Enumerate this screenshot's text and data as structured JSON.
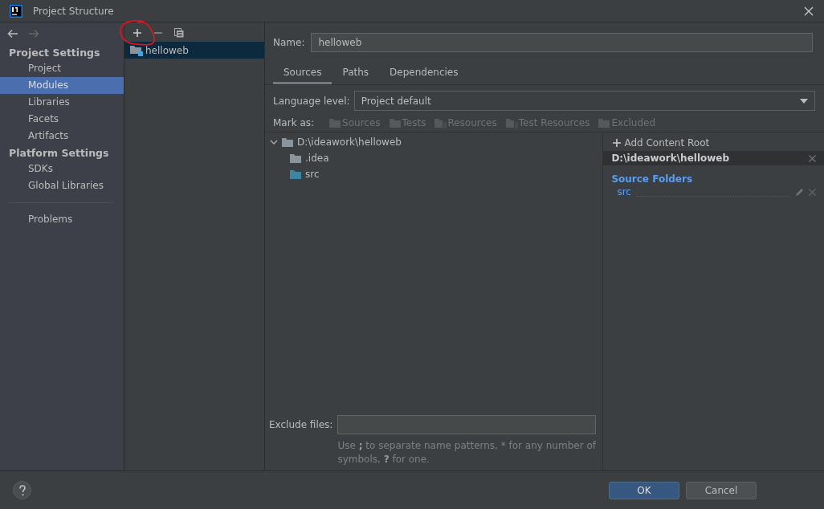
{
  "window": {
    "title": "Project Structure"
  },
  "sidebar": {
    "sections": [
      {
        "heading": "Project Settings",
        "items": [
          {
            "label": "Project",
            "selected": false
          },
          {
            "label": "Modules",
            "selected": true
          },
          {
            "label": "Libraries",
            "selected": false
          },
          {
            "label": "Facets",
            "selected": false
          },
          {
            "label": "Artifacts",
            "selected": false
          }
        ]
      },
      {
        "heading": "Platform Settings",
        "items": [
          {
            "label": "SDKs",
            "selected": false
          },
          {
            "label": "Global Libraries",
            "selected": false
          }
        ]
      }
    ],
    "extra_items": [
      {
        "label": "Problems",
        "selected": false
      }
    ]
  },
  "modules": [
    {
      "label": "helloweb",
      "selected": true
    }
  ],
  "name_field": {
    "label": "Name:",
    "value": "helloweb"
  },
  "tabs": [
    {
      "label": "Sources",
      "selected": true
    },
    {
      "label": "Paths",
      "selected": false
    },
    {
      "label": "Dependencies",
      "selected": false
    }
  ],
  "language_level": {
    "label": "Language level:",
    "value": "Project default"
  },
  "mark_as": {
    "label": "Mark as:",
    "items": [
      {
        "label": "Sources",
        "kind": "sources",
        "disabled": true
      },
      {
        "label": "Tests",
        "kind": "tests",
        "disabled": true
      },
      {
        "label": "Resources",
        "kind": "resources",
        "disabled": true
      },
      {
        "label": "Test Resources",
        "kind": "test-resources",
        "disabled": true
      },
      {
        "label": "Excluded",
        "kind": "excluded",
        "disabled": true
      }
    ]
  },
  "tree": [
    {
      "label": "D:\\ideawork\\helloweb",
      "kind": "folder",
      "expanded": true,
      "children": [
        {
          "label": ".idea",
          "kind": "folder"
        },
        {
          "label": "src",
          "kind": "source"
        }
      ]
    }
  ],
  "content_roots": {
    "add_label": "Add Content Root",
    "root": "D:\\ideawork\\helloweb",
    "section": "Source Folders",
    "folders": [
      "src"
    ]
  },
  "exclude_files": {
    "label": "Exclude files:",
    "hint": "Use **;** to separate name patterns, * for any number of symbols, **?** for one."
  },
  "buttons": [
    {
      "label": "OK",
      "kind": "default"
    },
    {
      "label": "Cancel",
      "kind": "normal"
    }
  ]
}
